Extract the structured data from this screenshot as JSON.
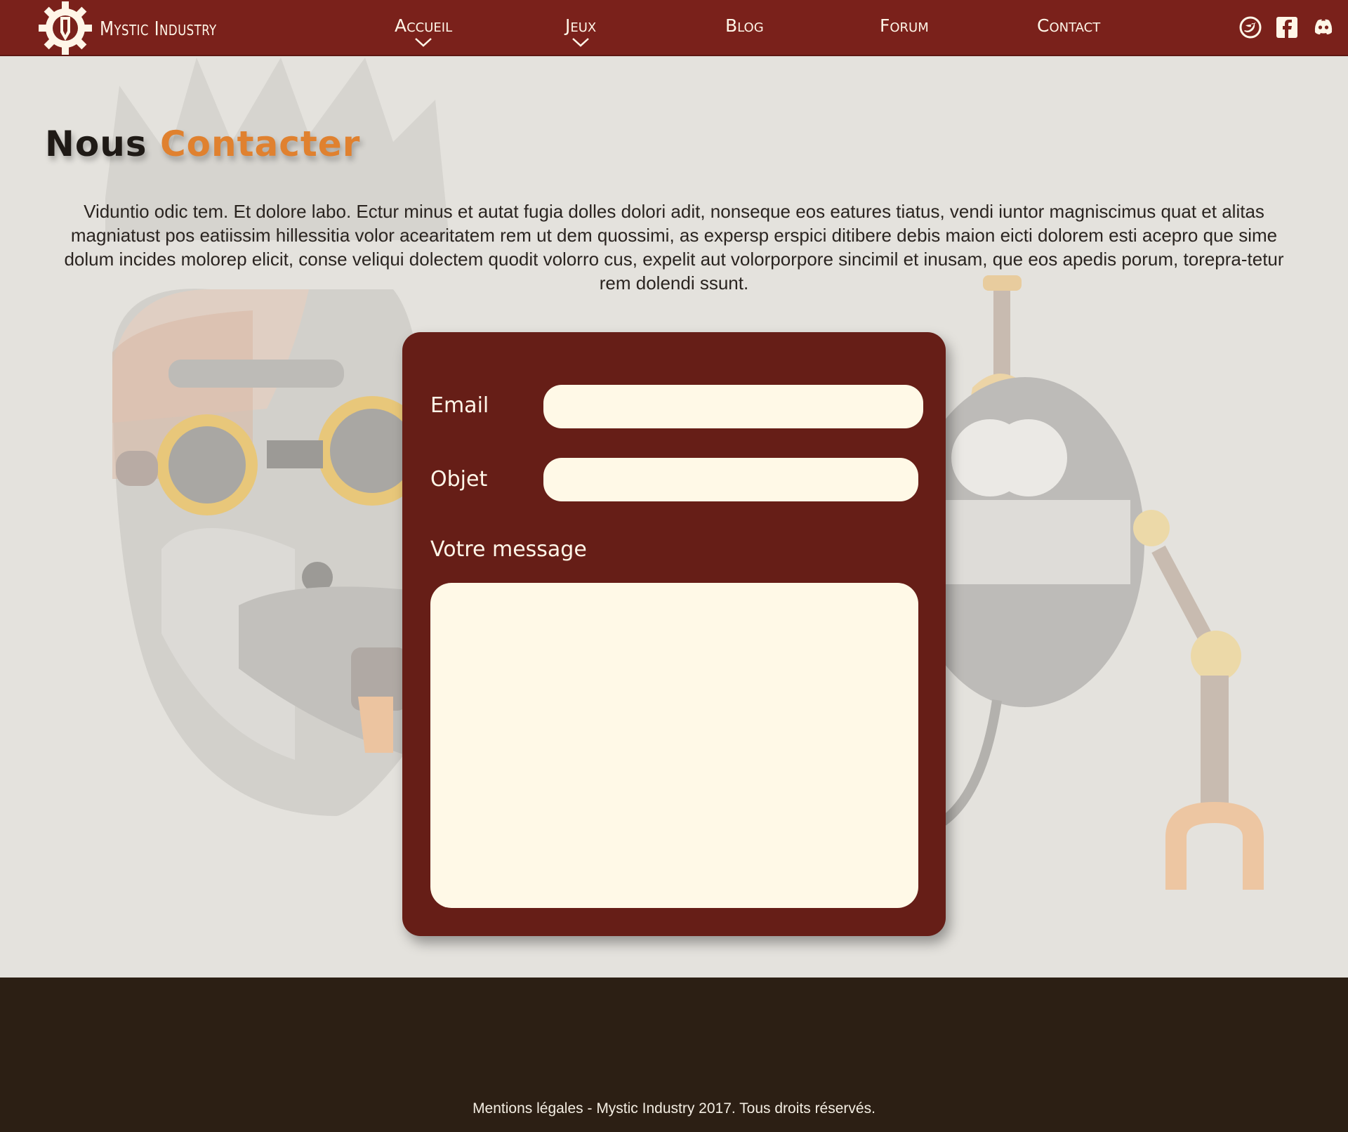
{
  "header": {
    "brand_name": "Mystic Industry",
    "nav": [
      {
        "label": "Accueil",
        "has_dropdown": true
      },
      {
        "label": "Jeux",
        "has_dropdown": true
      },
      {
        "label": "Blog",
        "has_dropdown": false
      },
      {
        "label": "Forum",
        "has_dropdown": false
      },
      {
        "label": "Contact",
        "has_dropdown": false
      }
    ],
    "socials": [
      "twitter-icon",
      "facebook-icon",
      "discord-icon"
    ]
  },
  "page": {
    "title_word1": "Nous",
    "title_word2": "Contacter",
    "intro": "Viduntio odic tem. Et dolore labo. Ectur minus et autat fugia dolles dolori adit, nonseque eos eatures tiatus, vendi iuntor magniscimus quat et alitas magniatust pos eatiissim hillessitia volor acearitatem rem ut dem quossimi, as expersp erspici ditibere debis maion eicti dolorem esti acepro que sime dolum incides molorep elicit, conse veliqui dolectem quodit volorro cus, expelit aut volorporpore sincimil et inusam, que eos apedis porum, torepra-tetur rem dolendi ssunt."
  },
  "form": {
    "email_label": "Email",
    "email_value": "",
    "subject_label": "Objet",
    "subject_value": "",
    "message_label": "Votre message",
    "message_value": ""
  },
  "footer": {
    "text": "Mentions légales - Mystic Industry 2017. Tous droits réservés."
  },
  "colors": {
    "header_bg": "#7a211b",
    "card_bg": "#661e17",
    "field_bg": "#fff9e7",
    "accent": "#e0812f",
    "footer_bg": "#2c1f14",
    "page_bg": "#e4e2dd"
  }
}
